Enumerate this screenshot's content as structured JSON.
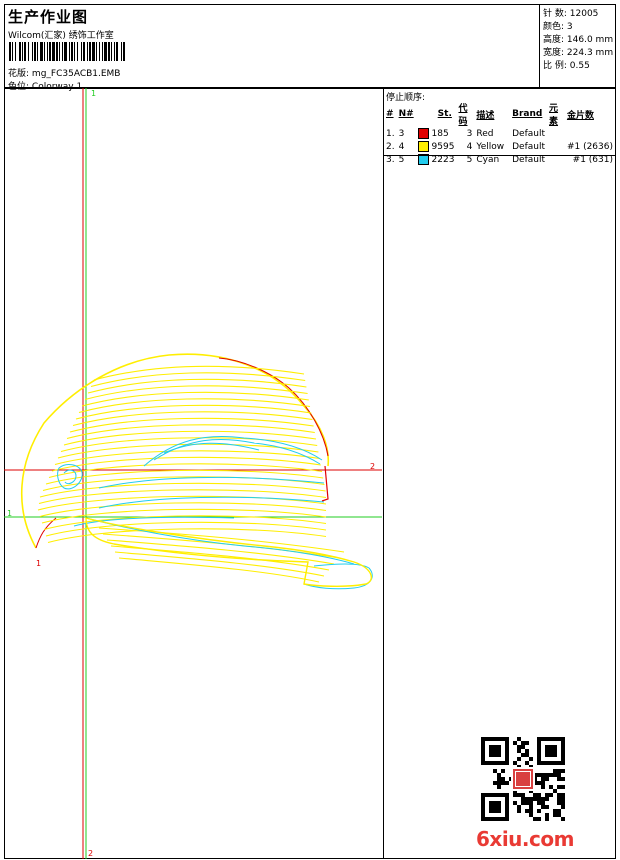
{
  "header": {
    "title": "生产作业图",
    "company": "Wilcom(汇家) 绣饰工作室",
    "pattern_label": "花版:",
    "pattern_value": "mg_FC35ACB1.EMB",
    "colorway_label": "色位:",
    "colorway_value": "Colorway 1"
  },
  "stats": [
    {
      "label": "针 数:",
      "value": "12005"
    },
    {
      "label": "颜色:",
      "value": "3"
    },
    {
      "label": "高度:",
      "value": "146.0 mm"
    },
    {
      "label": "宽度:",
      "value": "224.3 mm"
    },
    {
      "label": "比 例:",
      "value": "0.55"
    }
  ],
  "stop_sequence": {
    "title": "停止顺序:",
    "columns": [
      "#",
      "N#",
      "St.",
      "代码",
      "描述",
      "Brand",
      "元素",
      "金片数"
    ],
    "rows": [
      {
        "index": "1.",
        "n": "3",
        "color": "#e00000",
        "stitches": "185",
        "code": "3",
        "desc": "Red",
        "brand": "Default",
        "element": "",
        "sequins": ""
      },
      {
        "index": "2.",
        "n": "4",
        "color": "#ffee00",
        "stitches": "9595",
        "code": "4",
        "desc": "Yellow",
        "brand": "Default",
        "element": "",
        "sequins": "#1 (2636)"
      },
      {
        "index": "3.",
        "n": "5",
        "color": "#22ccee",
        "stitches": "2223",
        "code": "5",
        "desc": "Cyan",
        "brand": "Default",
        "element": "",
        "sequins": "#1 (631)"
      }
    ]
  },
  "markers": {
    "m1_top": "1",
    "m1_left": "1",
    "m1_bottom": "1",
    "m2_right": "2",
    "m2_bottom": "2"
  },
  "colors": {
    "red": "#e00000",
    "yellow": "#ffee00",
    "cyan": "#22ccee",
    "green": "#22cc22",
    "guide_red": "#dd0000"
  },
  "watermark": "6xiu.com"
}
